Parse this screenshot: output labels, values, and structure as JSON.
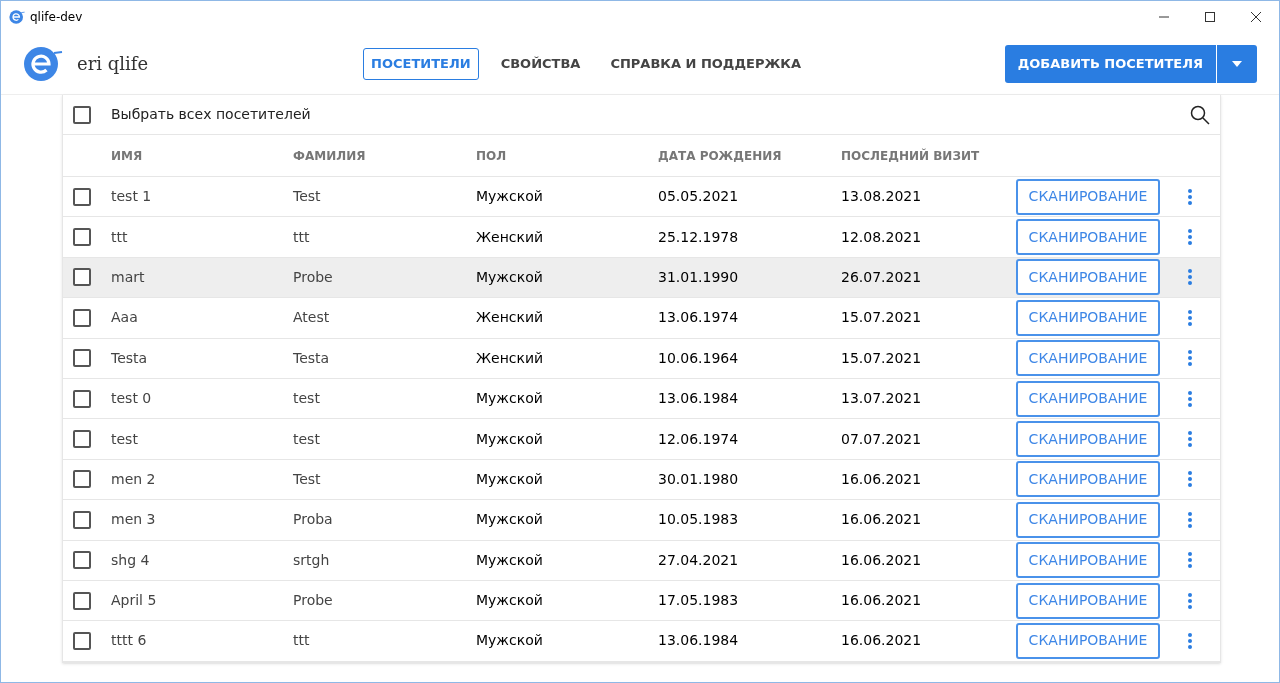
{
  "window": {
    "title": "qlife-dev"
  },
  "app": {
    "name": "eri qlife"
  },
  "nav": [
    {
      "label": "ПОСЕТИТЕЛИ",
      "selected": true
    },
    {
      "label": "СВОЙСТВА",
      "selected": false
    },
    {
      "label": "СПРАВКА И ПОДДЕРЖКА",
      "selected": false
    }
  ],
  "add_button": "ДОБАВИТЬ ПОСЕТИТЕЛЯ",
  "select_all": {
    "label": "Выбрать всех посетителей",
    "checked": false
  },
  "table": {
    "columns": [
      "ИМЯ",
      "ФАМИЛИЯ",
      "ПОЛ",
      "ДАТА РОЖДЕНИЯ",
      "ПОСЛЕДНИЙ ВИЗИТ"
    ],
    "rows": [
      {
        "name": "test 1",
        "surname": "Test",
        "gender": "Мужской",
        "birth": "05.05.2021",
        "last_visit": "13.08.2021",
        "action": "СКАНИРОВАНИЕ",
        "checked": false,
        "highlighted": false
      },
      {
        "name": "ttt",
        "surname": "ttt",
        "gender": "Женский",
        "birth": "25.12.1978",
        "last_visit": "12.08.2021",
        "action": "СКАНИРОВАНИЕ",
        "checked": false,
        "highlighted": false
      },
      {
        "name": "mart",
        "surname": "Probe",
        "gender": "Мужской",
        "birth": "31.01.1990",
        "last_visit": "26.07.2021",
        "action": "СКАНИРОВАНИЕ",
        "checked": false,
        "highlighted": true
      },
      {
        "name": "Aaa",
        "surname": "Atest",
        "gender": "Женский",
        "birth": "13.06.1974",
        "last_visit": "15.07.2021",
        "action": "СКАНИРОВАНИЕ",
        "checked": false,
        "highlighted": false
      },
      {
        "name": "Testa",
        "surname": "Testa",
        "gender": "Женский",
        "birth": "10.06.1964",
        "last_visit": "15.07.2021",
        "action": "СКАНИРОВАНИЕ",
        "checked": false,
        "highlighted": false
      },
      {
        "name": "test 0",
        "surname": "test",
        "gender": "Мужской",
        "birth": "13.06.1984",
        "last_visit": "13.07.2021",
        "action": "СКАНИРОВАНИЕ",
        "checked": false,
        "highlighted": false
      },
      {
        "name": "test",
        "surname": "test",
        "gender": "Мужской",
        "birth": "12.06.1974",
        "last_visit": "07.07.2021",
        "action": "СКАНИРОВАНИЕ",
        "checked": false,
        "highlighted": false
      },
      {
        "name": "men 2",
        "surname": "Test",
        "gender": "Мужской",
        "birth": "30.01.1980",
        "last_visit": "16.06.2021",
        "action": "СКАНИРОВАНИЕ",
        "checked": false,
        "highlighted": false
      },
      {
        "name": "men 3",
        "surname": "Proba",
        "gender": "Мужской",
        "birth": "10.05.1983",
        "last_visit": "16.06.2021",
        "action": "СКАНИРОВАНИЕ",
        "checked": false,
        "highlighted": false
      },
      {
        "name": "shg 4",
        "surname": "srtgh",
        "gender": "Мужской",
        "birth": "27.04.2021",
        "last_visit": "16.06.2021",
        "action": "СКАНИРОВАНИЕ",
        "checked": false,
        "highlighted": false
      },
      {
        "name": "April 5",
        "surname": "Probe",
        "gender": "Мужской",
        "birth": "17.05.1983",
        "last_visit": "16.06.2021",
        "action": "СКАНИРОВАНИЕ",
        "checked": false,
        "highlighted": false
      },
      {
        "name": "tttt 6",
        "surname": "ttt",
        "gender": "Мужской",
        "birth": "13.06.1984",
        "last_visit": "16.06.2021",
        "action": "СКАНИРОВАНИЕ",
        "checked": false,
        "highlighted": false
      }
    ]
  }
}
